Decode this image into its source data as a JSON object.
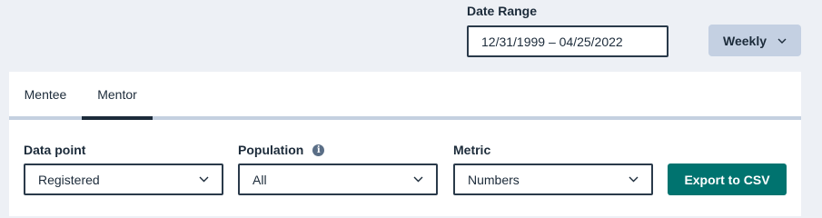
{
  "date_range": {
    "label": "Date Range",
    "value": "12/31/1999 – 04/25/2022"
  },
  "interval": {
    "selected": "Weekly",
    "icon": "chevron-down-icon"
  },
  "tabs": [
    {
      "label": "Mentee",
      "active": false
    },
    {
      "label": "Mentor",
      "active": true
    }
  ],
  "filters": {
    "data_point": {
      "label": "Data point",
      "value": "Registered"
    },
    "population": {
      "label": "Population",
      "value": "All",
      "info_icon": "info-icon"
    },
    "metric": {
      "label": "Metric",
      "value": "Numbers"
    }
  },
  "export": {
    "label": "Export to CSV"
  },
  "colors": {
    "background": "#edf0f5",
    "accent": "#00736f",
    "weekly_button": "#c4d0e2",
    "text": "#1c2b3a"
  }
}
